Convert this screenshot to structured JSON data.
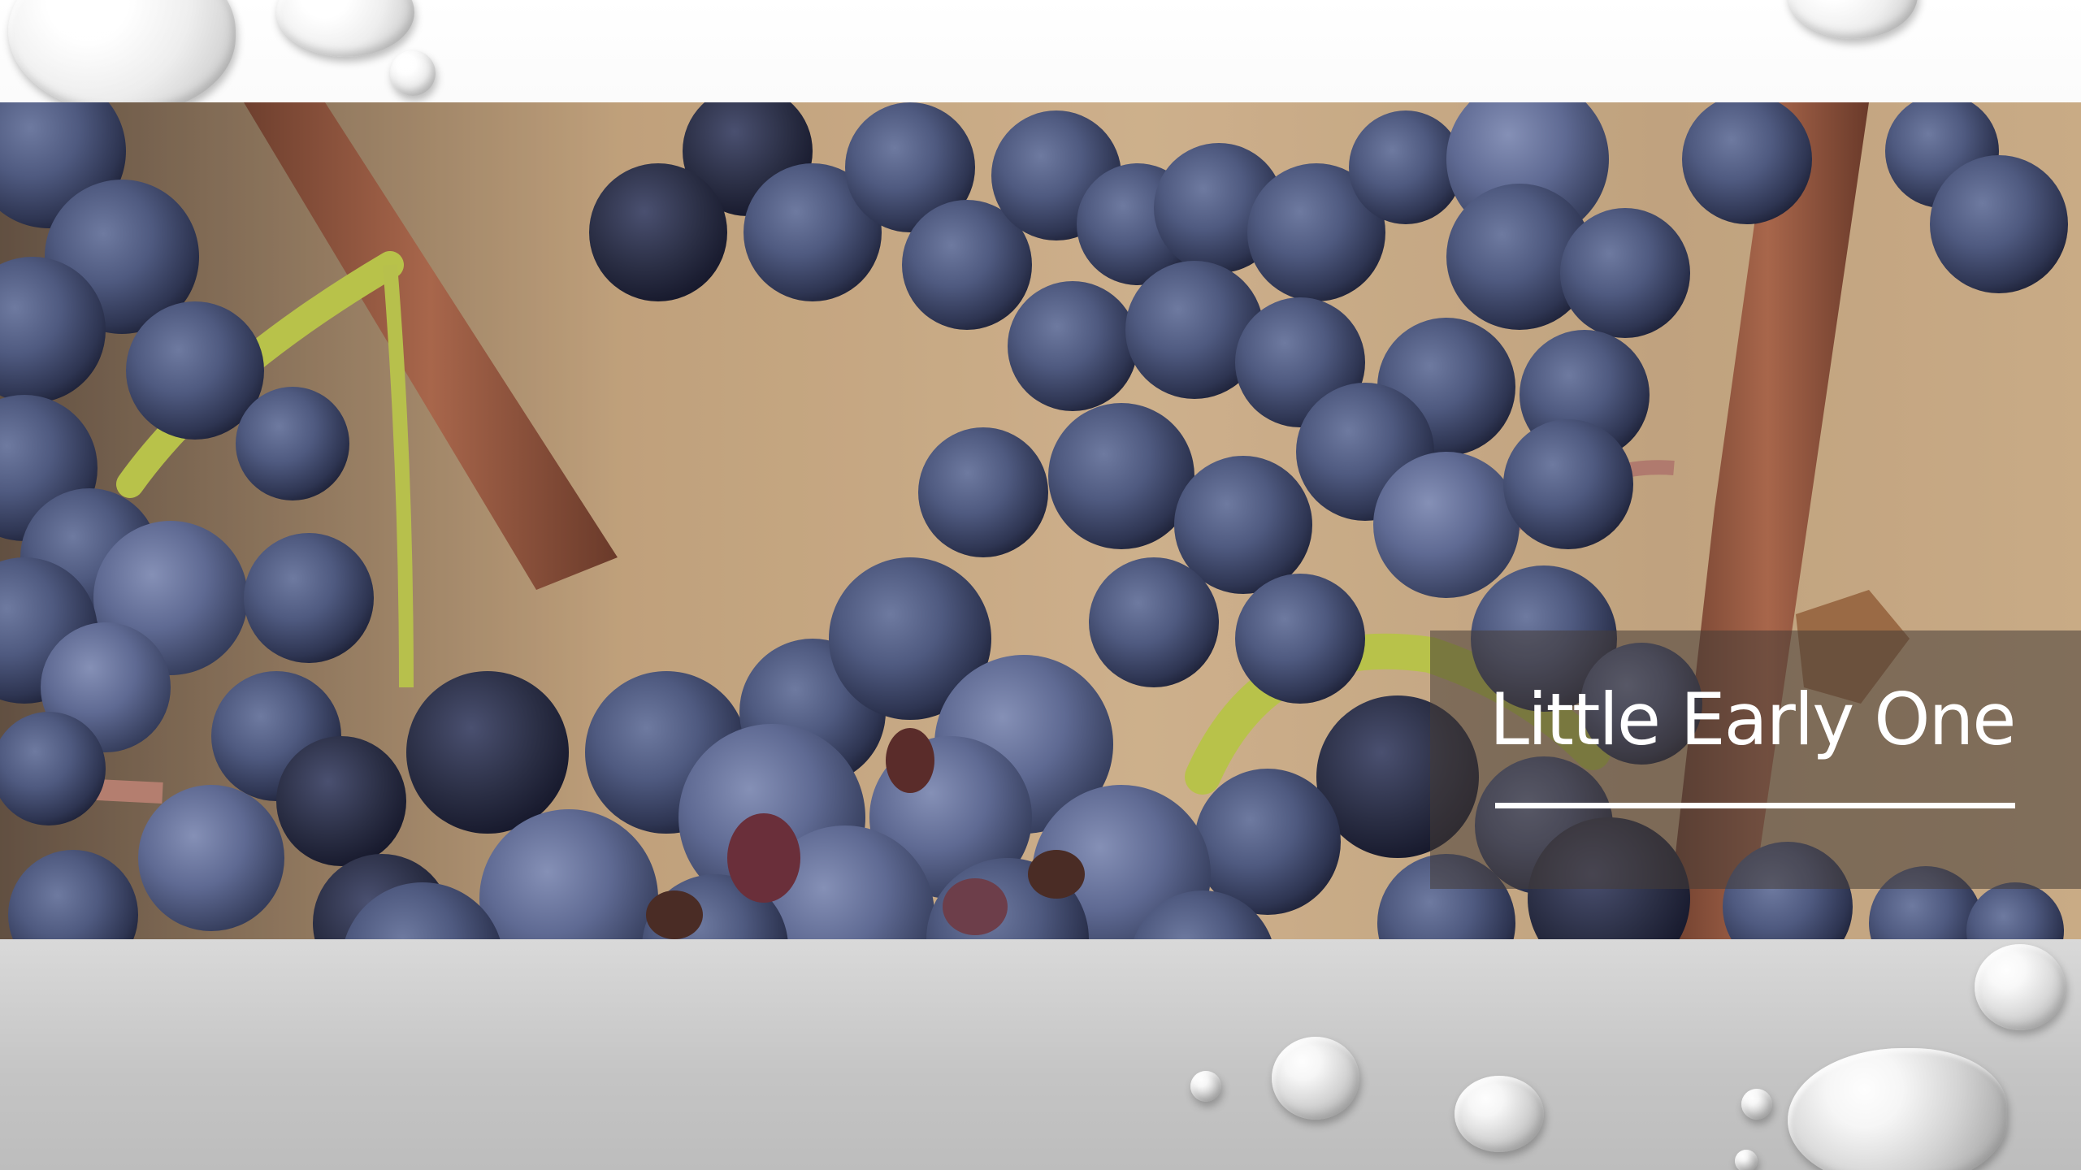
{
  "slide": {
    "title": "Little Early One"
  },
  "photo": {
    "subject": "grapes-photo"
  },
  "colors": {
    "title_text": "#ffffff",
    "title_panel": "#463c37",
    "background_top": "#ffffff",
    "background_bottom": "#c4c4c4"
  }
}
